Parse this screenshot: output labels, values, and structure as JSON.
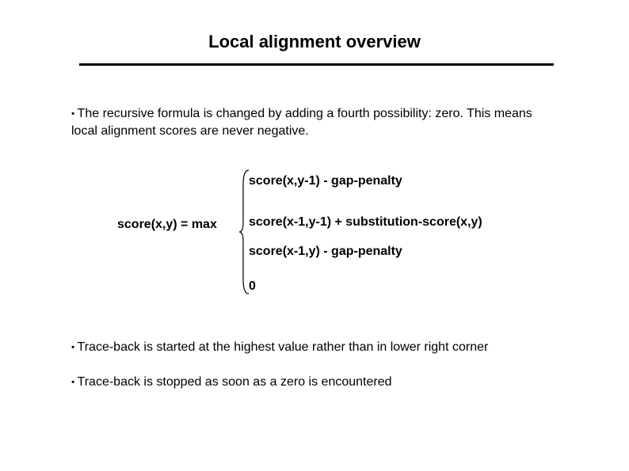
{
  "title": "Local alignment overview",
  "bullet1": "The recursive formula is changed by adding a fourth possibility: zero. This means local alignment scores are never negative.",
  "formula": {
    "lhs": "score(x,y) = max",
    "options": [
      "score(x,y-1) - gap-penalty",
      "score(x-1,y-1) + substitution-score(x,y)",
      "score(x-1,y) - gap-penalty",
      "0"
    ]
  },
  "bullet2": "Trace-back is started at the highest value rather than in lower right corner",
  "bullet3": "Trace-back is stopped as soon as a zero is encountered"
}
